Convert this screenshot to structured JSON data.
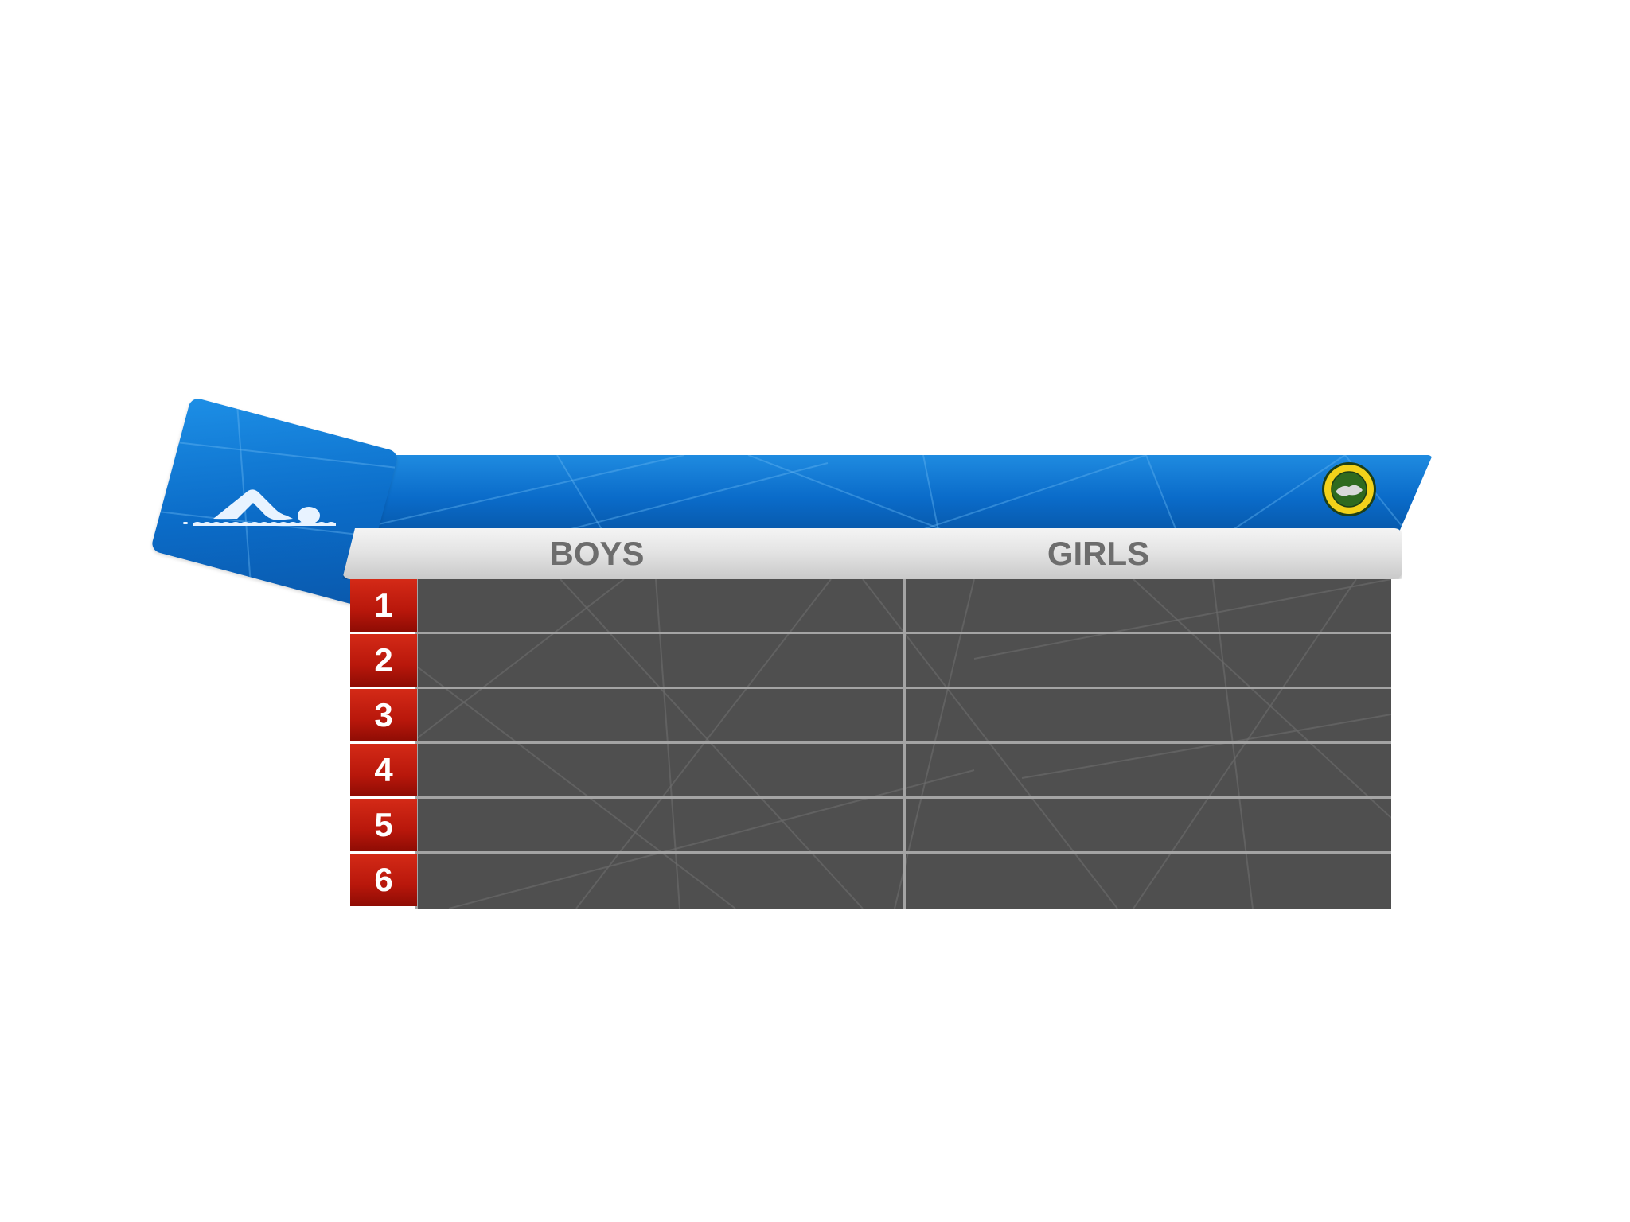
{
  "scoreboard": {
    "columns": {
      "boys_label": "BOYS",
      "girls_label": "GIRLS"
    },
    "rows": [
      {
        "rank": "1",
        "boys": "",
        "girls": ""
      },
      {
        "rank": "2",
        "boys": "",
        "girls": ""
      },
      {
        "rank": "3",
        "boys": "",
        "girls": ""
      },
      {
        "rank": "4",
        "boys": "",
        "girls": ""
      },
      {
        "rank": "5",
        "boys": "",
        "girls": ""
      },
      {
        "rank": "6",
        "boys": "",
        "girls": ""
      }
    ]
  },
  "icons": {
    "sport_icon": "swimmer-icon",
    "school_logo": "school-logo"
  },
  "colors": {
    "banner_blue": "#0a6bc9",
    "rank_red": "#c11d0e",
    "table_grey": "#4f4f4f",
    "header_text": "#6d6d6d"
  }
}
